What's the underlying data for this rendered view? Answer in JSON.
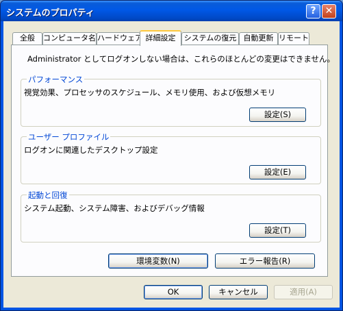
{
  "window": {
    "title": "システムのプロパティ",
    "help_glyph": "?",
    "close_glyph": "✕"
  },
  "tabs": [
    {
      "label": "全般"
    },
    {
      "label": "コンピュータ名"
    },
    {
      "label": "ハードウェア"
    },
    {
      "label": "詳細設定"
    },
    {
      "label": "システムの復元"
    },
    {
      "label": "自動更新"
    },
    {
      "label": "リモート"
    }
  ],
  "active_tab": "詳細設定",
  "notice": "Administrator としてログオンしない場合は、これらのほとんどの変更はできません。",
  "sections": {
    "performance": {
      "title": "パフォーマンス",
      "desc": "視覚効果、プロセッサのスケジュール、メモリ使用、および仮想メモリ",
      "button": "設定(S)"
    },
    "profile": {
      "title": "ユーザー プロファイル",
      "desc": "ログオンに関連したデスクトップ設定",
      "button": "設定(E)"
    },
    "startup": {
      "title": "起動と回復",
      "desc": "システム起動、システム障害、およびデバッグ情報",
      "button": "設定(T)"
    }
  },
  "buttons": {
    "env": "環境変数(N)",
    "error": "エラー報告(R)",
    "ok": "OK",
    "cancel": "キャンセル",
    "apply": "適用(A)"
  },
  "colors": {
    "title_bar": "#0054e3",
    "dialog_bg": "#ece9d8",
    "group_title": "#0046d5",
    "active_tab_highlight": "#ffc83c"
  }
}
